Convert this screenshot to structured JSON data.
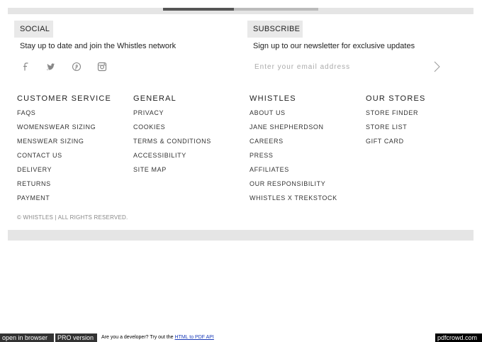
{
  "social": {
    "heading": "SOCIAL",
    "tagline": "Stay up to date and join the Whistles network",
    "icons": [
      "facebook-icon",
      "twitter-icon",
      "pinterest-icon",
      "instagram-icon"
    ]
  },
  "subscribe": {
    "heading": "SUBSCRIBE",
    "tagline": "Sign up to our newsletter for exclusive updates",
    "email_placeholder": "Enter your email address",
    "submit_icon": "chevron-right-icon"
  },
  "columns": [
    {
      "title": "CUSTOMER SERVICE",
      "items": [
        "FAQS",
        "WOMENSWEAR SIZING",
        "MENSWEAR SIZING",
        "CONTACT US",
        "DELIVERY",
        "RETURNS",
        "PAYMENT"
      ]
    },
    {
      "title": "GENERAL",
      "items": [
        "PRIVACY",
        "COOKIES",
        "TERMS & CONDITIONS",
        "ACCESSIBILITY",
        "SITE MAP"
      ]
    },
    {
      "title": "WHISTLES",
      "items": [
        "ABOUT US",
        "JANE SHEPHERDSON",
        "CAREERS",
        "PRESS",
        "AFFILIATES",
        "OUR RESPONSIBILITY",
        "WHISTLES X TREKSTOCK"
      ]
    },
    {
      "title": "OUR STORES",
      "items": [
        "STORE FINDER",
        "STORE LIST",
        "GIFT CARD"
      ]
    }
  ],
  "copyright": "© WHISTLES | ALL RIGHTS RESERVED.",
  "pdfcrowd": {
    "open_in_browser": "open in browser",
    "pro_version": "PRO version",
    "developer_text": "Are you a developer? Try out the",
    "api_link": "HTML to PDF API",
    "brand": "pdfcrowd.com"
  },
  "colors": {
    "bar_gray": "#e5e5e5",
    "tab_gray": "#e9e9e9",
    "text": "#222222",
    "link_blue": "#1a3bb8"
  }
}
